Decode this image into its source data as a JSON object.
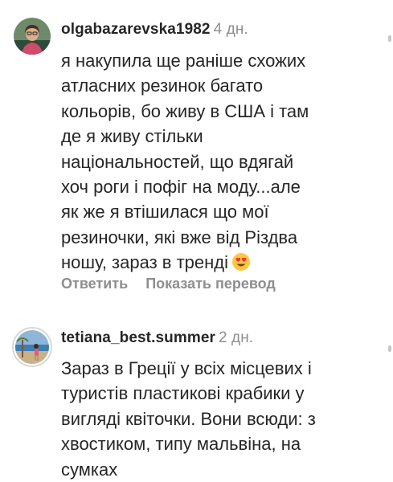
{
  "comments": [
    {
      "username": "olgabazarevska1982",
      "time": "4 дн.",
      "lines": [
        "я накупила ще раніше схожих",
        "атласних резинок багато",
        "кольорів, бо живу в США і там",
        "де я живу стільки",
        "національностей, що вдягай",
        "хоч роги і пофіг на моду...але",
        "як же я втішилася що мої",
        "резиночки, які вже від Різдва",
        "ношу, зараз в тренді"
      ],
      "emoji": "smiling-face-with-heart-eyes",
      "actions": {
        "reply": "Ответить",
        "translate": "Показать перевод"
      }
    },
    {
      "username": "tetiana_best.summer",
      "time": "2 дн.",
      "lines": [
        "Зараз в Греції у всіх місцевих і",
        "туристів пластикові крабики у",
        "вигляді квіточки. Вони всюди: з",
        "хвостиком,  типу мальвіна, на",
        "сумках"
      ]
    }
  ]
}
